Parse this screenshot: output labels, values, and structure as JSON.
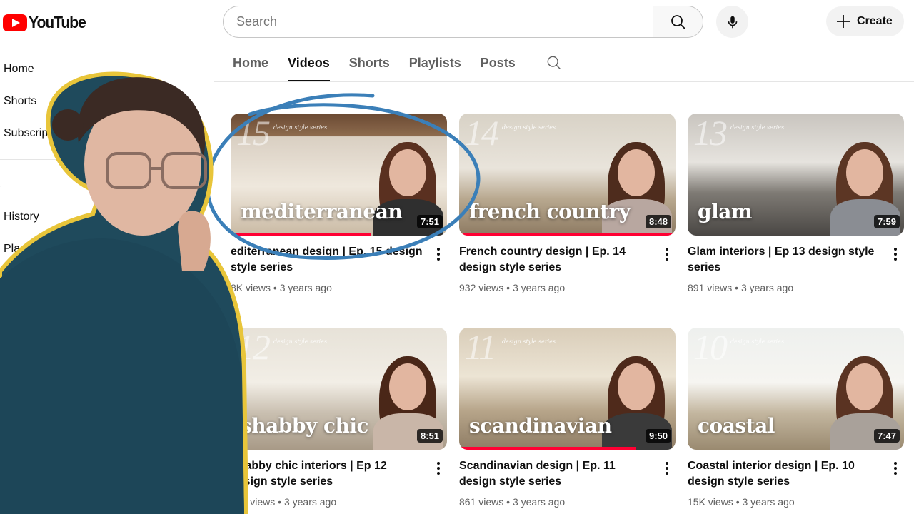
{
  "masthead": {
    "logo_text": "YouTube",
    "search_placeholder": "Search",
    "create_label": "Create",
    "icons": {
      "search": "search-icon",
      "mic": "mic-icon",
      "create": "plus-icon"
    }
  },
  "sidebar": {
    "items": [
      {
        "label": "Home"
      },
      {
        "label": "Shorts"
      },
      {
        "label": "Subscrip"
      },
      {
        "label": "History"
      },
      {
        "label": "Pla"
      }
    ]
  },
  "tabs": [
    {
      "label": "Home",
      "active": false
    },
    {
      "label": "Videos",
      "active": true
    },
    {
      "label": "Shorts",
      "active": false
    },
    {
      "label": "Playlists",
      "active": false
    },
    {
      "label": "Posts",
      "active": false
    }
  ],
  "videos": [
    {
      "episode": "15",
      "thumb_text": "mediterranean",
      "series_tag": "design style series",
      "duration": "7:51",
      "watched": 0.65,
      "title": "editerranean design | Ep. 15 design style series",
      "views": "8K views",
      "age": "3 years ago"
    },
    {
      "episode": "14",
      "thumb_text": "french country",
      "series_tag": "design style series",
      "duration": "8:48",
      "watched": 1.0,
      "title": "French country design | Ep. 14 design style series",
      "views": "932 views",
      "age": "3 years ago"
    },
    {
      "episode": "13",
      "thumb_text": "glam",
      "series_tag": "design style series",
      "duration": "7:59",
      "watched": 0,
      "title": "Glam interiors | Ep 13 design style series",
      "views": "891 views",
      "age": "3 years ago"
    },
    {
      "episode": "12",
      "thumb_text": "shabby chic",
      "series_tag": "design style series",
      "duration": "8:51",
      "watched": 0,
      "title": "Shabby chic interiors | Ep 12 design style series",
      "views": "430 views",
      "age": "3 years ago"
    },
    {
      "episode": "11",
      "thumb_text": "scandinavian",
      "series_tag": "design style series",
      "duration": "9:50",
      "watched": 0.82,
      "title": "Scandinavian design | Ep. 11 design style series",
      "views": "861 views",
      "age": "3 years ago"
    },
    {
      "episode": "10",
      "thumb_text": "coastal",
      "series_tag": "design style series",
      "duration": "7:47",
      "watched": 0,
      "title": "Coastal interior design | Ep. 10 design style series",
      "views": "15K views",
      "age": "3 years ago"
    }
  ],
  "colors": {
    "brand_red": "#ff0000",
    "progress_red": "#ff0033",
    "annotation_blue": "#3b7fb8",
    "cutout_outline": "#e8c53a"
  }
}
